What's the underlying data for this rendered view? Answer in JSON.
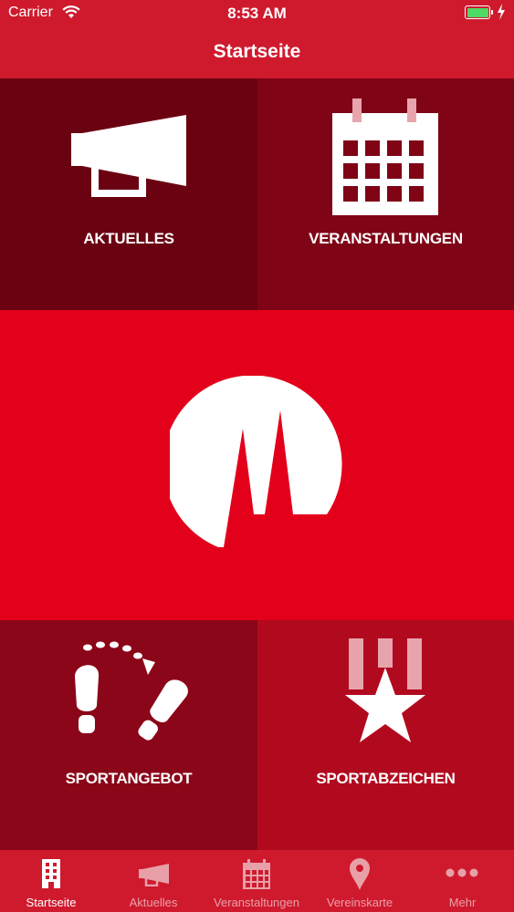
{
  "status_bar": {
    "carrier": "Carrier",
    "time": "8:53 AM",
    "battery_level": 1.0
  },
  "nav": {
    "title": "Startseite"
  },
  "tiles": {
    "aktuelles": {
      "label": "AKTUELLES",
      "icon": "megaphone-icon"
    },
    "veranstaltungen": {
      "label": "VERANSTALTUNGEN",
      "icon": "calendar-icon"
    },
    "logo": {
      "icon": "club-logo-icon"
    },
    "sportangebot": {
      "label": "SPORTANGEBOT",
      "icon": "footsteps-icon"
    },
    "sportabzeichen": {
      "label": "SPORTABZEICHEN",
      "icon": "medal-star-icon"
    }
  },
  "tab_bar": {
    "active": "Startseite",
    "tabs": [
      {
        "label": "Startseite",
        "icon": "building-icon"
      },
      {
        "label": "Aktuelles",
        "icon": "megaphone-icon"
      },
      {
        "label": "Veranstaltungen",
        "icon": "calendar-icon"
      },
      {
        "label": "Vereinskarte",
        "icon": "map-pin-icon"
      },
      {
        "label": "Mehr",
        "icon": "more-dots-icon"
      }
    ]
  },
  "colors": {
    "brand_red": "#e3001b",
    "bar_red": "#cf1a2e",
    "battery_green": "#4cd964"
  }
}
